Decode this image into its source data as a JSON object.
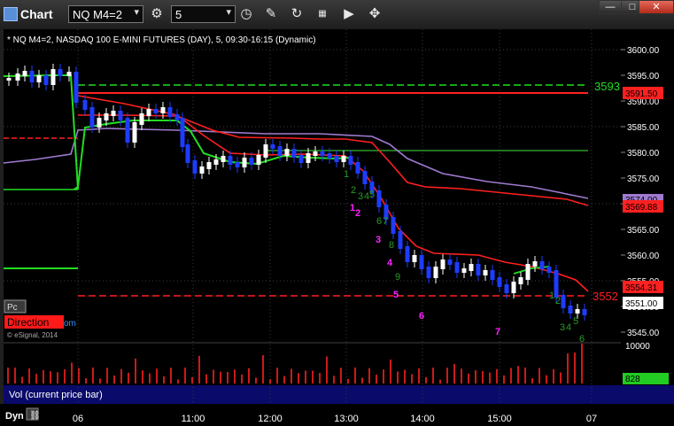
{
  "window": {
    "title": "Chart",
    "minimize": "—",
    "maximize": "□",
    "close": "✕"
  },
  "toolbar": {
    "symbol": "NQ M4=2",
    "interval": "5",
    "icons": [
      "gear-icon",
      "clock-icon",
      "pencil-icon",
      "refresh-icon",
      "study-icon",
      "play-icon",
      "crosshair-icon"
    ]
  },
  "chart": {
    "header": "* NQ M4=2, NASDAQ 100 E-MINI FUTURES (DAY), 5, 09:30-16:15 (Dynamic)",
    "watermark": "© eSignal, 2014",
    "price_axis": [
      "3600.00",
      "3595.00",
      "3590.00",
      "3585.00",
      "3580.00",
      "3575.00",
      "3570.00",
      "3565.00",
      "3560.00",
      "3555.00",
      "3550.00",
      "3545.00"
    ],
    "time_axis": [
      "06",
      "11:00",
      "12:00",
      "13:00",
      "14:00",
      "15:00",
      "07"
    ],
    "tags": {
      "level_3593": "3593",
      "price_3591": "3591.50",
      "price_3574": "3574.00",
      "price_3569": "3569.88",
      "price_3554": "3554.31",
      "level_3552": "3552",
      "price_last": "3551.00"
    },
    "badges": {
      "pc": "Pc",
      "direction": "Direction",
      "direction_suffix": "om"
    },
    "count_labels_green": [
      "1",
      "2",
      "3",
      "4",
      "5",
      "6",
      "7",
      "8",
      "9",
      "1",
      "2",
      "3",
      "4",
      "5",
      "6"
    ],
    "count_labels_magenta": [
      "1",
      "2",
      "3",
      "4",
      "5",
      "6",
      "7"
    ],
    "colors": {
      "bg": "#000000",
      "bull": "#ffffff",
      "bear": "#1e3cff",
      "red": "#ff2020",
      "green": "#22dd22",
      "purple": "#a07ad0",
      "magenta": "#ff22ff",
      "darkgreen": "#2a9a2a",
      "volume": "#cc1a1a"
    }
  },
  "volume": {
    "label": "Vol (current price bar)",
    "axis_top": "10000",
    "current": "828"
  },
  "bottom": {
    "tab": "Dyn"
  }
}
